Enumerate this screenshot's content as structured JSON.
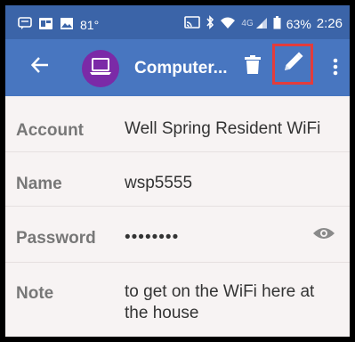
{
  "status_bar": {
    "temperature": "81°",
    "battery": "63%",
    "time": "2:26",
    "network": "4G",
    "icons": [
      "message-icon",
      "notification-icon",
      "image-icon",
      "cast-icon",
      "bluetooth-icon",
      "wifi-icon",
      "signal-icon",
      "battery-icon"
    ]
  },
  "app_bar": {
    "title": "Computer...",
    "icons": [
      "back-arrow-icon",
      "laptop-icon",
      "trash-icon",
      "pencil-icon",
      "more-vert-icon"
    ],
    "colors": {
      "status": "#3b64a8",
      "bar": "#4876c0",
      "avatar": "#7b2aa7",
      "highlight": "#e33c3c"
    }
  },
  "fields": [
    {
      "label": "Account",
      "value": "Well Spring Resident WiFi"
    },
    {
      "label": "Name",
      "value": "wsp5555"
    },
    {
      "label": "Password",
      "value": "••••••••"
    },
    {
      "label": "Note",
      "value_line1": "to get on the WiFi here at",
      "value_line2": "the house"
    }
  ]
}
